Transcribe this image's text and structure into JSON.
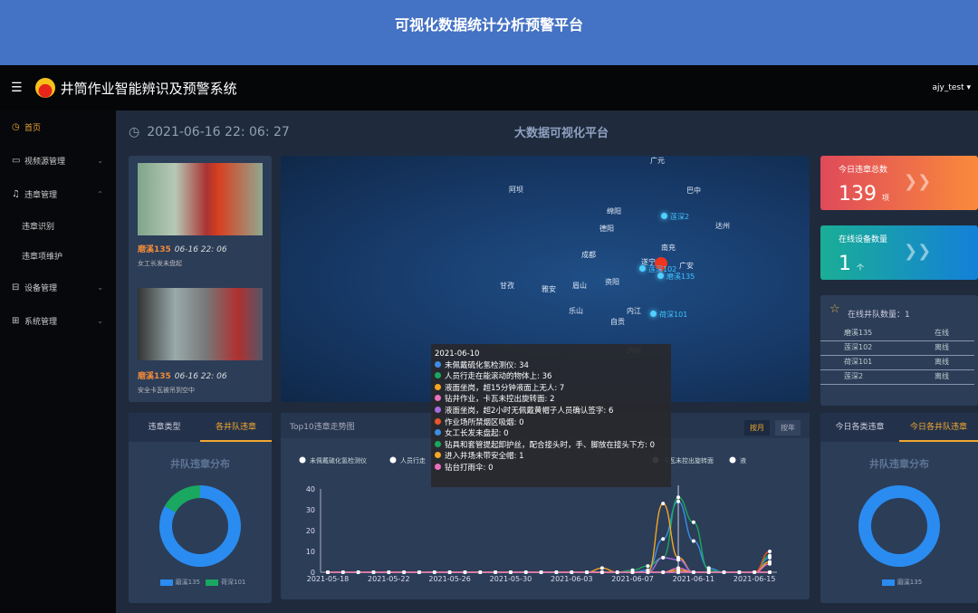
{
  "banner": {
    "title": "可视化数据统计分析预警平台"
  },
  "header": {
    "app_title": "井筒作业智能辨识及预警系统",
    "user": "ajy_test ▾"
  },
  "sidebar": [
    {
      "label": "首页",
      "icon": "◷",
      "active": true
    },
    {
      "label": "视频源管理",
      "icon": "▭",
      "chev": "⌄"
    },
    {
      "label": "违章管理",
      "icon": "♫",
      "chev": "⌃"
    },
    {
      "label": "违章识别",
      "sub": true
    },
    {
      "label": "违章项维护",
      "sub": true
    },
    {
      "label": "设备管理",
      "icon": "⊟",
      "chev": "⌄"
    },
    {
      "label": "系统管理",
      "icon": "⊞",
      "chev": "⌄"
    }
  ],
  "main": {
    "datetime": "2021-06-16 22: 06: 27",
    "title": "大数据可视化平台"
  },
  "alerts": [
    {
      "team": "磨溪135",
      "time": "06-16 22: 06",
      "desc": "女工长发未盘起"
    },
    {
      "team": "磨溪135",
      "time": "06-16 22: 06",
      "desc": "安全卡瓦被吊到空中"
    }
  ],
  "map": {
    "cities": [
      "广元",
      "阿坝",
      "巴中",
      "绵阳",
      "德阳",
      "达州",
      "南充",
      "遂宁",
      "广安",
      "成都",
      "甘孜",
      "雅安",
      "眉山",
      "资阳",
      "乐山",
      "内江",
      "自贡",
      "泸州"
    ],
    "sites": [
      "莲深2",
      "莲深102",
      "磨溪135",
      "荷深101"
    ]
  },
  "stats": [
    {
      "label": "今日违章总数",
      "value": "139",
      "unit": "项"
    },
    {
      "label": "在线设备数量",
      "value": "1",
      "unit": "个"
    }
  ],
  "teams": {
    "header": "在线井队数量：1",
    "rows": [
      [
        "磨溪135",
        "在线"
      ],
      [
        "莲深102",
        "离线"
      ],
      [
        "荷深101",
        "离线"
      ],
      [
        "莲深2",
        "离线"
      ]
    ]
  },
  "left_donut": {
    "tabs": [
      "违章类型",
      "各井队违章"
    ],
    "title": "井队违章分布",
    "legend": [
      "磨溪135",
      "荷深101"
    ],
    "values": [
      83,
      17
    ]
  },
  "right_donut": {
    "tabs": [
      "今日各类违章",
      "今日各井队违章"
    ],
    "title": "井队违章分布",
    "legend": [
      "磨溪135"
    ],
    "values": [
      100
    ]
  },
  "trend": {
    "title": "Top10违章走势图",
    "buttons": [
      "按月",
      "按年"
    ]
  },
  "chart_data": {
    "type": "line",
    "title": "Top10违章走势图",
    "ylim": [
      0,
      40
    ],
    "yticks": [
      0,
      10,
      20,
      30,
      40
    ],
    "x": [
      "2021-05-18",
      "2021-05-19",
      "2021-05-20",
      "2021-05-21",
      "2021-05-22",
      "2021-05-23",
      "2021-05-24",
      "2021-05-25",
      "2021-05-26",
      "2021-05-27",
      "2021-05-28",
      "2021-05-29",
      "2021-05-30",
      "2021-05-31",
      "2021-06-01",
      "2021-06-02",
      "2021-06-03",
      "2021-06-04",
      "2021-06-05",
      "2021-06-06",
      "2021-06-07",
      "2021-06-08",
      "2021-06-09",
      "2021-06-10",
      "2021-06-11",
      "2021-06-12",
      "2021-06-13",
      "2021-06-14",
      "2021-06-15",
      "2021-06-16"
    ],
    "xticks": [
      "2021-05-18",
      "2021-05-22",
      "2021-05-26",
      "2021-05-30",
      "2021-06-03",
      "2021-06-07",
      "2021-06-11",
      "2021-06-15"
    ],
    "legend_visible": [
      "未佩戴硫化氢检测仪",
      "人员行走",
      "卡瓦未控出旋转面",
      "液"
    ],
    "tooltip_date": "2021-06-10",
    "series": [
      {
        "name": "未佩戴硫化氢检测仪",
        "color": "#3a8ee6",
        "values": [
          0,
          0,
          0,
          0,
          0,
          0,
          0,
          0,
          0,
          0,
          0,
          0,
          0,
          0,
          0,
          0,
          0,
          0,
          0,
          0,
          0,
          1,
          16,
          34,
          15,
          2,
          0,
          0,
          0,
          7
        ]
      },
      {
        "name": "人员行走在能滚动的物体上",
        "color": "#1aa760",
        "values": [
          0,
          0,
          0,
          0,
          0,
          0,
          0,
          0,
          0,
          0,
          0,
          0,
          0,
          0,
          0,
          0,
          0,
          0,
          0,
          0,
          1,
          3,
          7,
          36,
          24,
          1,
          0,
          0,
          0,
          8
        ]
      },
      {
        "name": "液面坐岗，超15分钟液面上无人",
        "color": "#f5a623",
        "values": [
          0,
          0,
          0,
          0,
          0,
          0,
          0,
          0,
          0,
          0,
          0,
          0,
          0,
          0,
          0,
          0,
          0,
          0,
          2,
          0,
          0,
          0,
          33,
          7,
          0,
          0,
          0,
          0,
          0,
          5
        ]
      },
      {
        "name": "钻井作业，卡瓦未控出旋转面",
        "color": "#e86fbf",
        "values": [
          0,
          0,
          0,
          0,
          0,
          0,
          0,
          0,
          0,
          0,
          0,
          0,
          0,
          0,
          0,
          0,
          0,
          0,
          0,
          0,
          0,
          0,
          0,
          2,
          0,
          0,
          0,
          0,
          0,
          4
        ]
      },
      {
        "name": "液面坐岗，超2小时无佩戴黄帽子人员确认签字",
        "color": "#a56be0",
        "values": [
          0,
          0,
          0,
          0,
          0,
          0,
          0,
          0,
          0,
          0,
          0,
          0,
          0,
          0,
          0,
          0,
          0,
          0,
          0,
          0,
          0,
          0,
          7,
          6,
          0,
          0,
          0,
          0,
          0,
          0
        ]
      },
      {
        "name": "作业场所禁烟区吸烟",
        "color": "#e8552a",
        "values": [
          0,
          0,
          0,
          0,
          0,
          0,
          0,
          0,
          0,
          0,
          0,
          0,
          0,
          0,
          0,
          0,
          0,
          0,
          0,
          0,
          0,
          0,
          0,
          0,
          0,
          0,
          0,
          0,
          0,
          10
        ]
      },
      {
        "name": "女工长发未盘起",
        "color": "#3a8ee6",
        "values": [
          0,
          0,
          0,
          0,
          0,
          0,
          0,
          0,
          0,
          0,
          0,
          0,
          0,
          0,
          0,
          0,
          0,
          0,
          0,
          0,
          0,
          0,
          0,
          0,
          0,
          0,
          0,
          0,
          0,
          0
        ]
      },
      {
        "name": "钻具和套管提起卸护丝，配合接头时，手、脚放在接头下方",
        "color": "#1aa760",
        "values": [
          0,
          0,
          0,
          0,
          0,
          0,
          0,
          0,
          0,
          0,
          0,
          0,
          0,
          0,
          0,
          0,
          0,
          0,
          0,
          0,
          0,
          0,
          0,
          0,
          0,
          0,
          0,
          0,
          0,
          0
        ]
      },
      {
        "name": "进入井场未带安全帽",
        "color": "#f5a623",
        "values": [
          0,
          0,
          0,
          0,
          0,
          0,
          0,
          0,
          0,
          0,
          0,
          0,
          0,
          0,
          0,
          0,
          0,
          0,
          0,
          0,
          0,
          0,
          0,
          1,
          0,
          0,
          0,
          0,
          0,
          0
        ]
      },
      {
        "name": "钻台打雨伞",
        "color": "#e86fbf",
        "values": [
          0,
          0,
          0,
          0,
          0,
          0,
          0,
          0,
          0,
          0,
          0,
          0,
          0,
          0,
          0,
          0,
          0,
          0,
          0,
          0,
          0,
          0,
          0,
          0,
          0,
          0,
          0,
          0,
          0,
          0
        ]
      }
    ]
  }
}
